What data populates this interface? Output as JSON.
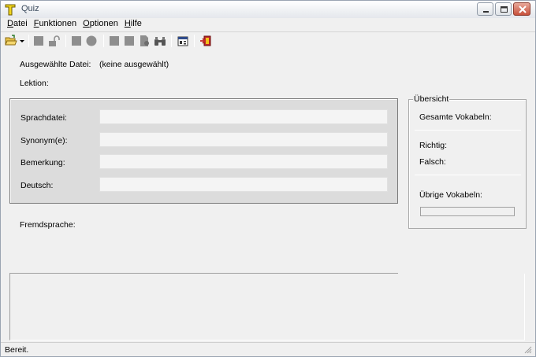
{
  "window": {
    "title": "Quiz"
  },
  "menu": {
    "items": [
      {
        "key": "D",
        "rest": "atei"
      },
      {
        "key": "F",
        "rest": "unktionen"
      },
      {
        "key": "O",
        "rest": "ptionen"
      },
      {
        "key": "H",
        "rest": "ilfe"
      }
    ]
  },
  "toolbar": {
    "icons": [
      "open-folder-icon",
      "dropdown-arrow-icon",
      "gray-square-icon",
      "unlock-icon",
      "gray-square-icon",
      "gray-circle-icon",
      "gray-square-icon",
      "gray-square-icon",
      "page-icon",
      "binoculars-icon",
      "properties-icon",
      "exit-icon"
    ]
  },
  "info": {
    "file_label": "Ausgewählte Datei:",
    "file_value": "(keine ausgewählt)",
    "lesson_label": "Lektion:"
  },
  "form": {
    "fields": [
      {
        "label": "Sprachdatei:",
        "value": ""
      },
      {
        "label": "Synonym(e):",
        "value": ""
      },
      {
        "label": "Bemerkung:",
        "value": ""
      },
      {
        "label": "Deutsch:",
        "value": ""
      }
    ],
    "foreign_label": "Fremdsprache:"
  },
  "overview": {
    "title": "Übersicht",
    "total_label": "Gesamte Vokabeln:",
    "correct_label": "Richtig:",
    "wrong_label": "Falsch:",
    "remaining_label": "Übrige Vokabeln:"
  },
  "status": {
    "text": "Bereit."
  }
}
